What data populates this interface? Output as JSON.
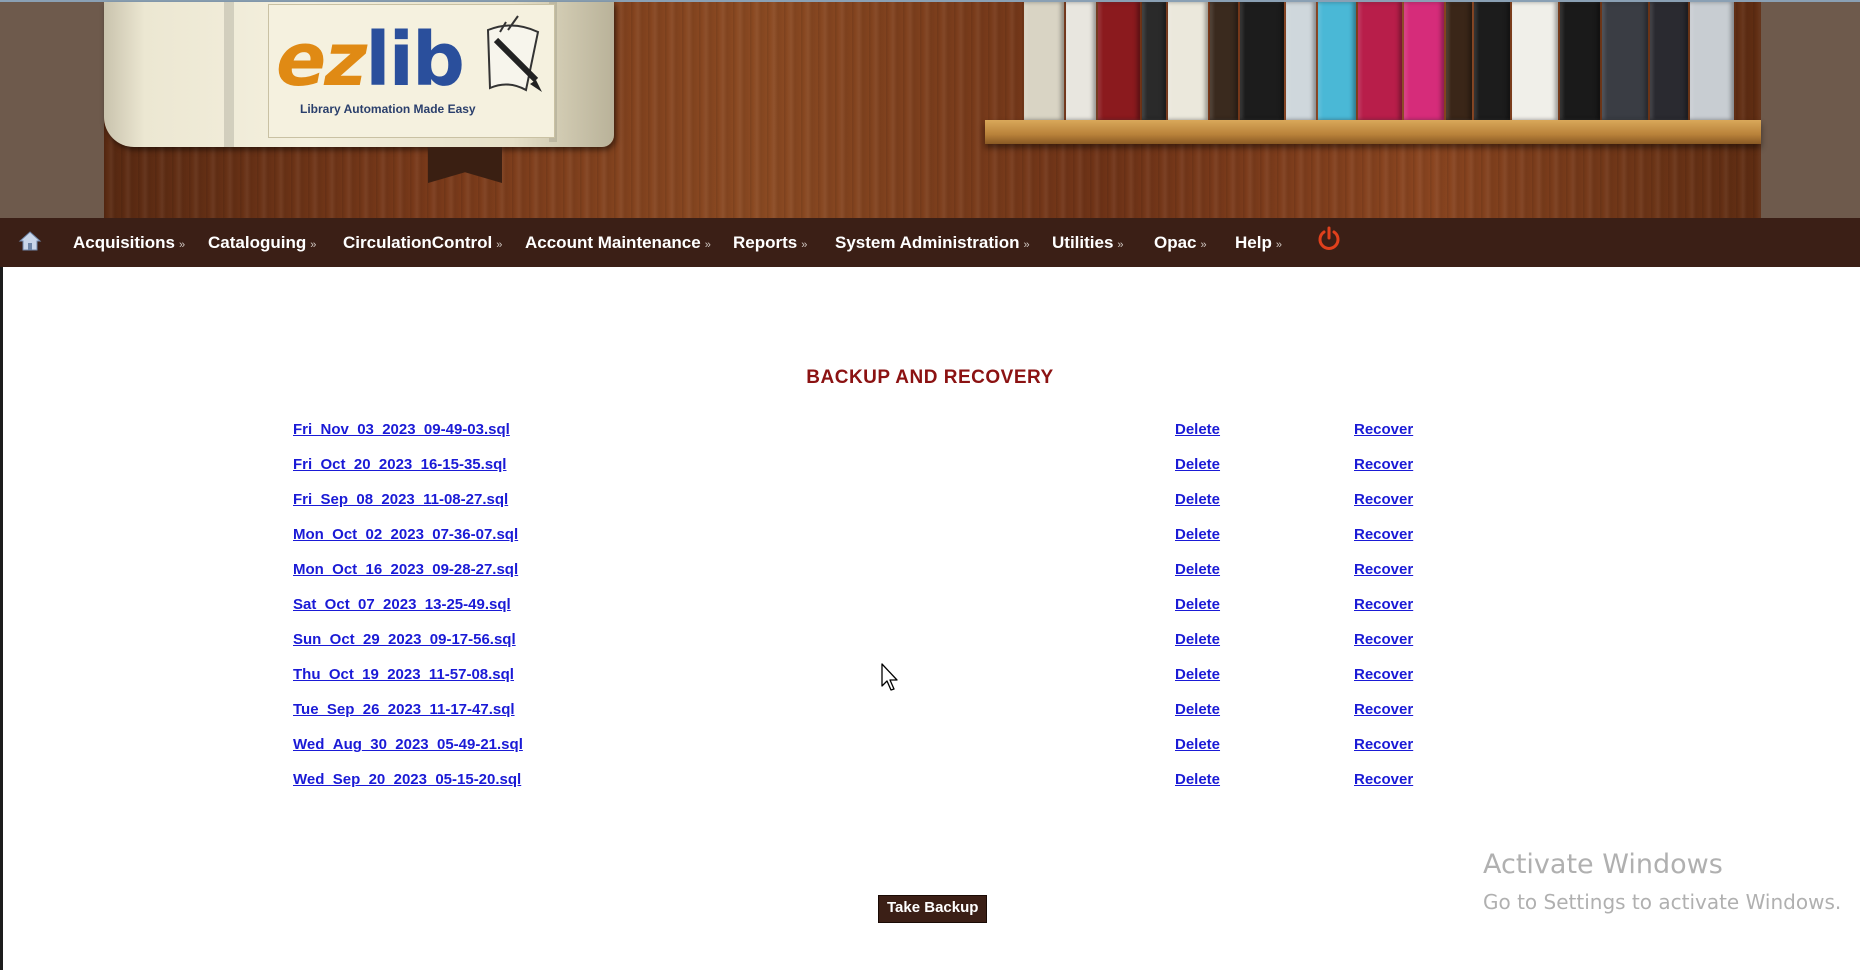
{
  "logo": {
    "text_ez": "ez",
    "text_lib": "lib",
    "tagline": "Library Automation Made Easy"
  },
  "nav": {
    "home_icon": "home-icon",
    "items": [
      {
        "label": "Acquisitions"
      },
      {
        "label": "Cataloguing"
      },
      {
        "label": "CirculationControl"
      },
      {
        "label": "Account Maintenance"
      },
      {
        "label": "Reports"
      },
      {
        "label": "System Administration"
      },
      {
        "label": "Utilities"
      },
      {
        "label": "Opac"
      },
      {
        "label": "Help"
      }
    ],
    "chevron": "»",
    "power_icon": "power-icon"
  },
  "page": {
    "title": "BACKUP AND RECOVERY"
  },
  "backups": {
    "delete_label": "Delete",
    "recover_label": "Recover",
    "files": [
      "Fri_Nov_03_2023_09-49-03.sql",
      "Fri_Oct_20_2023_16-15-35.sql",
      "Fri_Sep_08_2023_11-08-27.sql",
      "Mon_Oct_02_2023_07-36-07.sql",
      "Mon_Oct_16_2023_09-28-27.sql",
      "Sat_Oct_07_2023_13-25-49.sql",
      "Sun_Oct_29_2023_09-17-56.sql",
      "Thu_Oct_19_2023_11-57-08.sql",
      "Tue_Sep_26_2023_11-17-47.sql",
      "Wed_Aug_30_2023_05-49-21.sql",
      "Wed_Sep_20_2023_05-15-20.sql"
    ]
  },
  "actions": {
    "take_backup": "Take Backup"
  },
  "watermark": {
    "title": "Activate Windows",
    "subtitle": "Go to Settings to activate Windows."
  },
  "colors": {
    "nav_bg": "#3b1f16",
    "title": "#8b1212",
    "link": "#1a1ad6",
    "power": "#e0401c"
  }
}
